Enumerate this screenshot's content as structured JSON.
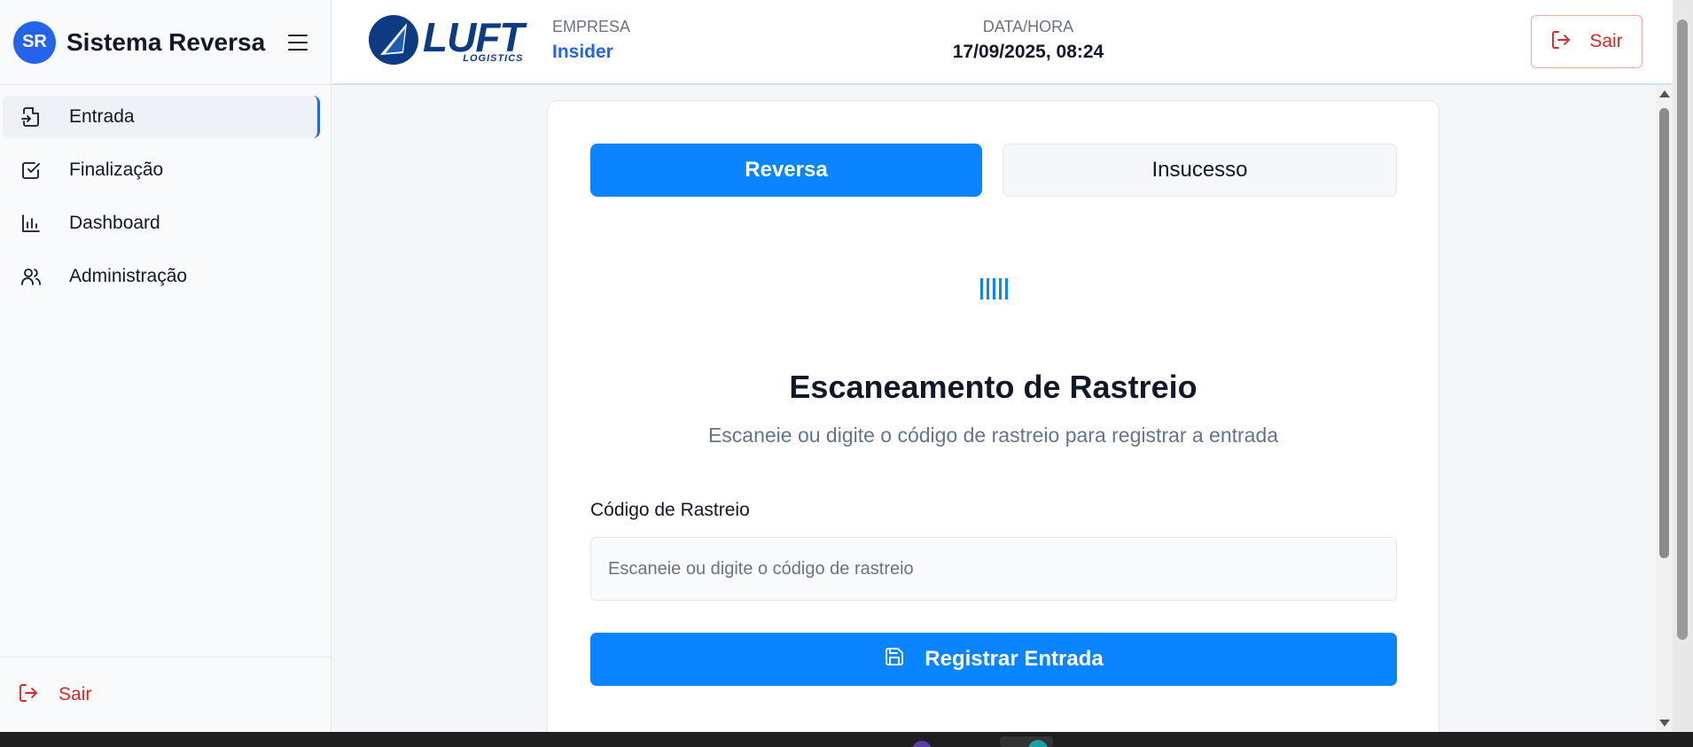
{
  "sidebar": {
    "avatar": "SR",
    "title": "Sistema Reversa",
    "items": [
      {
        "label": "Entrada",
        "icon": "file-import-icon",
        "active": true
      },
      {
        "label": "Finalização",
        "icon": "check-square-icon",
        "active": false
      },
      {
        "label": "Dashboard",
        "icon": "bar-chart-icon",
        "active": false
      },
      {
        "label": "Administração",
        "icon": "users-icon",
        "active": false
      }
    ],
    "logout_label": "Sair"
  },
  "header": {
    "logo_word": "LUFT",
    "logo_sub": "LOGISTICS",
    "company_key": "EMPRESA",
    "company_value": "Insider",
    "datetime_key": "DATA/HORA",
    "datetime_value": "17/09/2025, 08:24",
    "logout_label": "Sair"
  },
  "card": {
    "tabs": [
      {
        "label": "Reversa",
        "active": true
      },
      {
        "label": "Insucesso",
        "active": false
      }
    ],
    "icon": "barcode-icon",
    "title": "Escaneamento de Rastreio",
    "subtitle": "Escaneie ou digite o código de rastreio para registrar a entrada",
    "field_label": "Código de Rastreio",
    "field_placeholder": "Escaneie ou digite o código de rastreio",
    "field_value": "",
    "submit_label": "Registrar Entrada"
  },
  "colors": {
    "accent": "#0a84ff",
    "brand_blue": "#2563eb",
    "danger": "#dc2626",
    "logo_navy": "#0d3b83"
  }
}
